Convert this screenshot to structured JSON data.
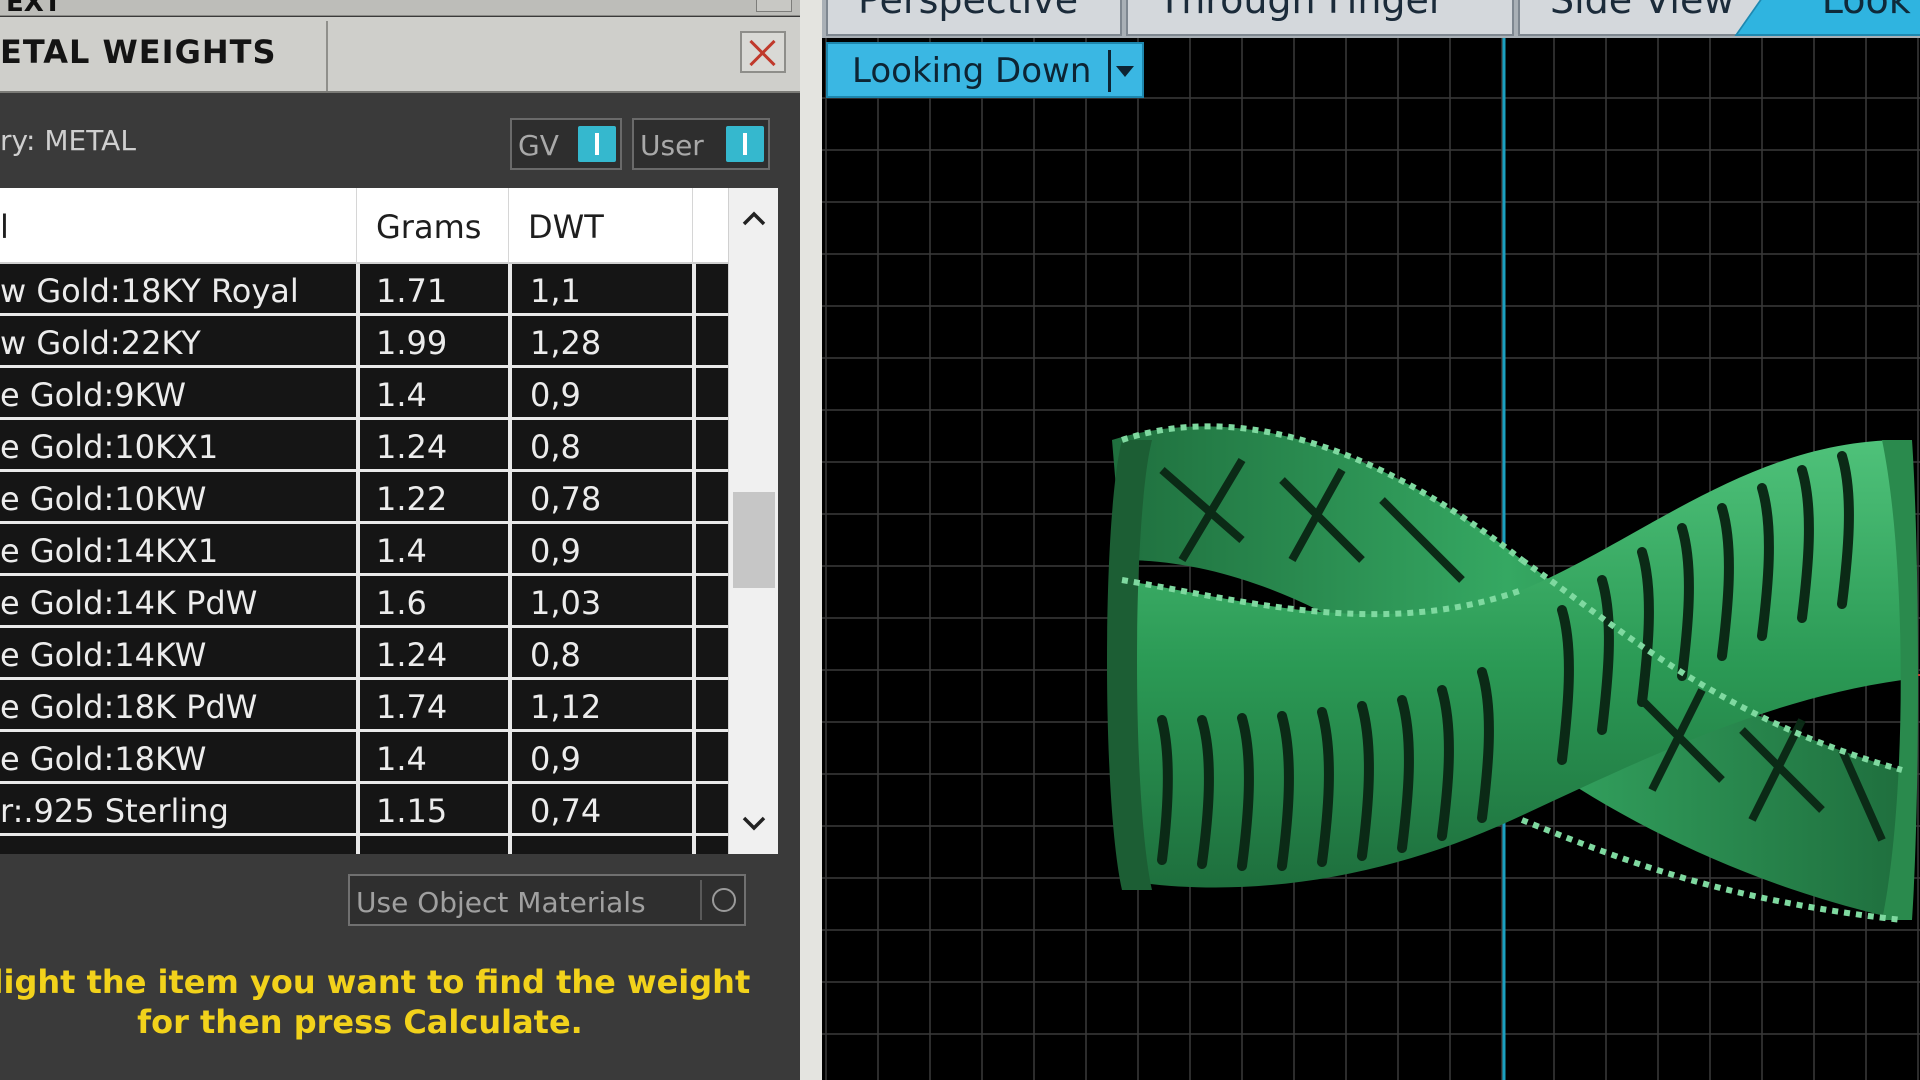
{
  "top_strip": {
    "text": "EXT"
  },
  "panel": {
    "title": "ETAL WEIGHTS",
    "category_label": "ry: METAL",
    "toggles": [
      {
        "label": "GV",
        "state": "on"
      },
      {
        "label": "User",
        "state": "on"
      }
    ]
  },
  "table": {
    "columns": [
      "l",
      "Grams",
      "DWT"
    ],
    "rows": [
      {
        "material": "w Gold:18KY Royal",
        "grams": "1.71",
        "dwt": "1,1"
      },
      {
        "material": "w Gold:22KY",
        "grams": "1.99",
        "dwt": "1,28"
      },
      {
        "material": "e Gold:9KW",
        "grams": "1.4",
        "dwt": "0,9"
      },
      {
        "material": "e Gold:10KX1",
        "grams": "1.24",
        "dwt": "0,8"
      },
      {
        "material": "e Gold:10KW",
        "grams": "1.22",
        "dwt": "0,78"
      },
      {
        "material": "e Gold:14KX1",
        "grams": "1.4",
        "dwt": "0,9"
      },
      {
        "material": "e Gold:14K PdW",
        "grams": "1.6",
        "dwt": "1,03"
      },
      {
        "material": "e Gold:14KW",
        "grams": "1.24",
        "dwt": "0,8"
      },
      {
        "material": "e Gold:18K PdW",
        "grams": "1.74",
        "dwt": "1,12"
      },
      {
        "material": "e Gold:18KW",
        "grams": "1.4",
        "dwt": "0,9"
      },
      {
        "material": "r:.925 Sterling",
        "grams": "1.15",
        "dwt": "0,74"
      }
    ]
  },
  "use_object_materials": {
    "label": "Use Object Materials"
  },
  "instructions": {
    "line1": "hlight the item you want to find the weight",
    "line2": "for then press Calculate."
  },
  "viewport": {
    "tabs": [
      "Perspective",
      "Through Finger",
      "Side View",
      "Look"
    ],
    "active_tab": "Look",
    "view_mode": "Looking Down"
  },
  "colors": {
    "accent": "#35b8ce",
    "instruction_text": "#f2d21b",
    "model": "#2e9a56",
    "viewport_bg": "#000000",
    "grid": "#3a3a3a",
    "axis": "#1aa0c0"
  }
}
